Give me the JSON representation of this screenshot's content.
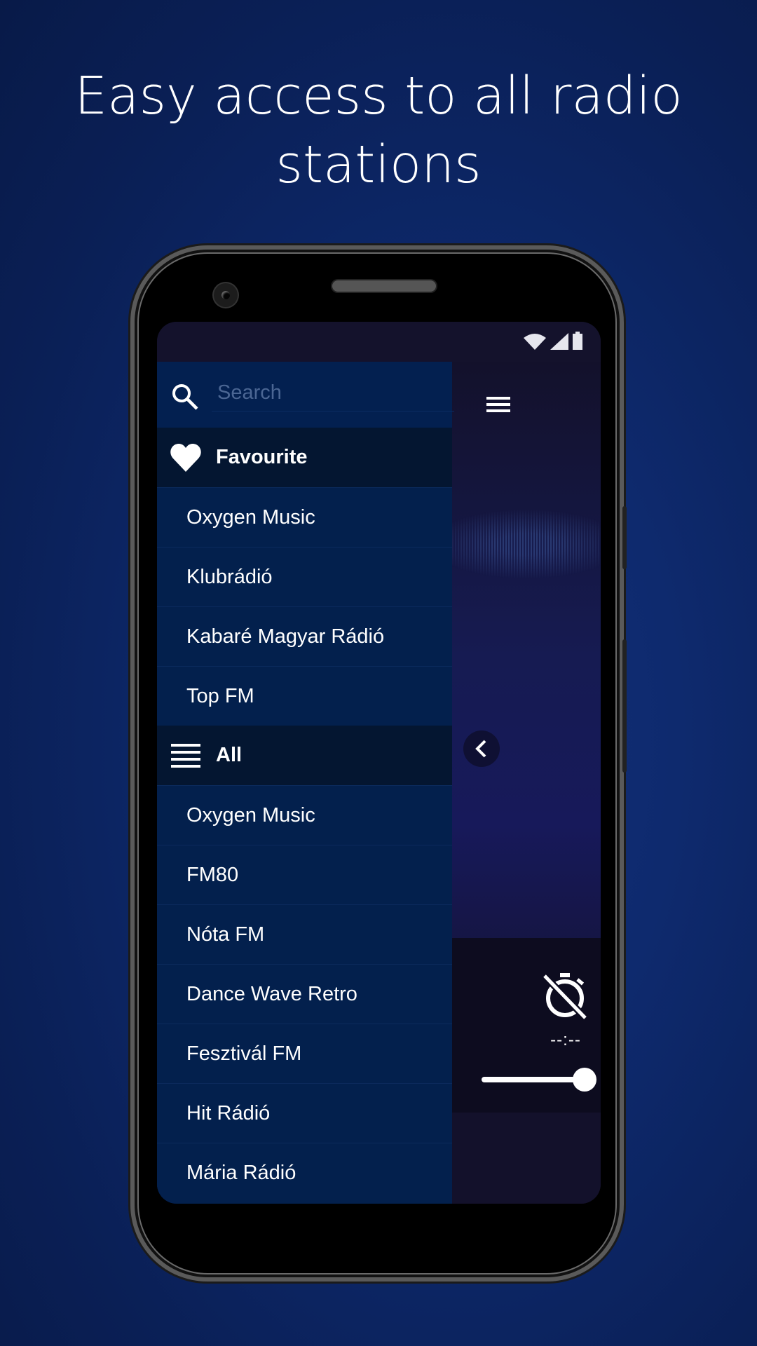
{
  "headline": {
    "line1": "Easy access to all radio",
    "line2": "stations"
  },
  "colors": {
    "background": "#0e2a6e",
    "drawer": "#03204d",
    "section_header": "#041631",
    "main_panel": "#13112b",
    "accent": "#ffffff"
  },
  "status_bar": {
    "icons": [
      "wifi-icon",
      "cellular-signal-icon",
      "battery-icon"
    ]
  },
  "search": {
    "placeholder": "Search",
    "value": ""
  },
  "favourite": {
    "icon": "heart-icon",
    "label": "Favourite",
    "items": [
      {
        "label": "Oxygen Music"
      },
      {
        "label": "Klubrádió"
      },
      {
        "label": "Kabaré Magyar Rádió"
      },
      {
        "label": "Top FM"
      }
    ]
  },
  "all": {
    "icon": "list-icon",
    "label": "All",
    "items": [
      {
        "label": "Oxygen Music"
      },
      {
        "label": "FM80"
      },
      {
        "label": "Nóta FM"
      },
      {
        "label": "Dance Wave Retro"
      },
      {
        "label": "Fesztivál FM"
      },
      {
        "label": "Hit Rádió"
      },
      {
        "label": "Mária Rádió"
      }
    ]
  },
  "player": {
    "menu_icon": "hamburger-menu-icon",
    "back_icon": "chevron-left-icon",
    "sleep_timer": {
      "icon": "timer-off-icon",
      "value": "--:--"
    },
    "volume": {
      "fraction": 1.0
    }
  }
}
